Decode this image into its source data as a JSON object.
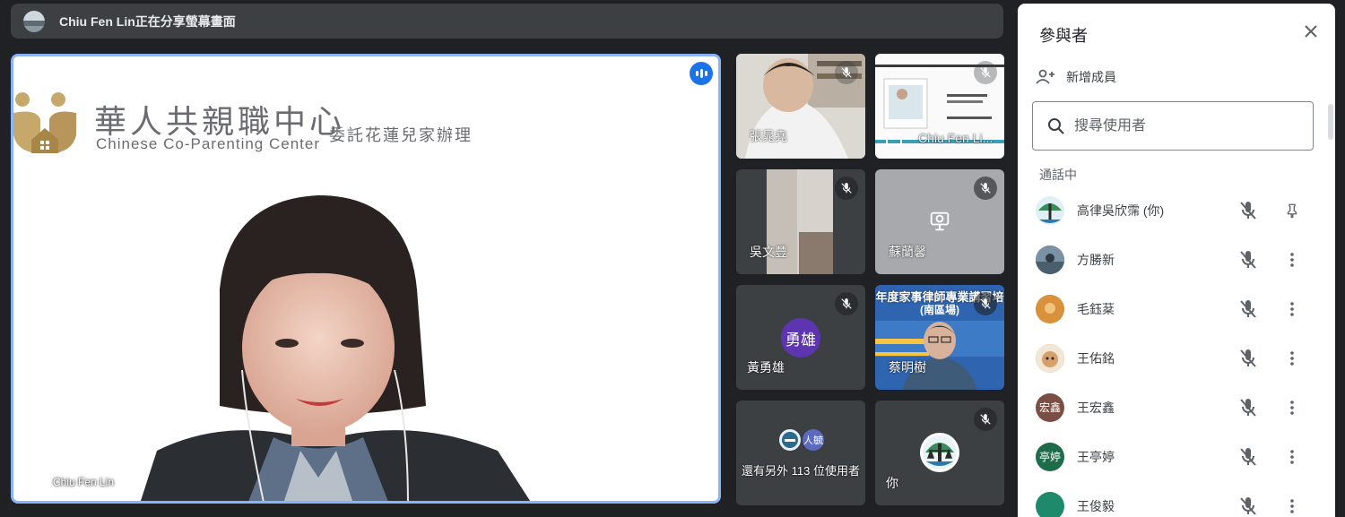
{
  "banner": {
    "text": "Chiu Fen Lin正在分享螢幕畫面"
  },
  "main_tile": {
    "org_title": "華人共親職中心",
    "org_subtitle": "Chinese Co-Parenting Center",
    "org_note": "委託花蓮兒家辦理",
    "presenter_name": "Chiu Fen Lin"
  },
  "tiles": [
    {
      "name": "張晁堯"
    },
    {
      "name": "Chiu Fen Li..."
    },
    {
      "name": "吳文豐"
    },
    {
      "name": "蘇蘭馨"
    },
    {
      "name": "黃勇雄",
      "avatar_text": "勇雄",
      "avatar_color": "#6a3fb5"
    },
    {
      "name": "蔡明樹",
      "banner_text": "年度家事律師專業講習培",
      "banner_sub": "(南區場)"
    },
    {
      "name": "還有另外 113 位使用者",
      "avatar_text": "人毓"
    },
    {
      "name": "你"
    }
  ],
  "panel": {
    "title": "參與者",
    "add_member": "新增成員",
    "search_placeholder": "搜尋使用者",
    "section_label": "通話中",
    "participants": [
      {
        "name": "高律吳欣霈 (你)",
        "avatar_text": "",
        "color": "#e8f0fe"
      },
      {
        "name": "方勝新",
        "avatar_text": "",
        "color": "#5f7a8c"
      },
      {
        "name": "毛鈺棻",
        "avatar_text": "",
        "color": "#d08a35"
      },
      {
        "name": "王佑銘",
        "avatar_text": "",
        "color": "#c89b6b"
      },
      {
        "name": "王宏鑫",
        "avatar_text": "宏鑫",
        "color": "#7a4e45"
      },
      {
        "name": "王亭婷",
        "avatar_text": "亭婷",
        "color": "#1e6b4a"
      },
      {
        "name": "王俊毅",
        "avatar_text": "",
        "color": "#1e8a6b"
      }
    ]
  },
  "colors": {
    "accent": "#1a73e8",
    "bg": "#202124",
    "tile": "#3c4043"
  }
}
